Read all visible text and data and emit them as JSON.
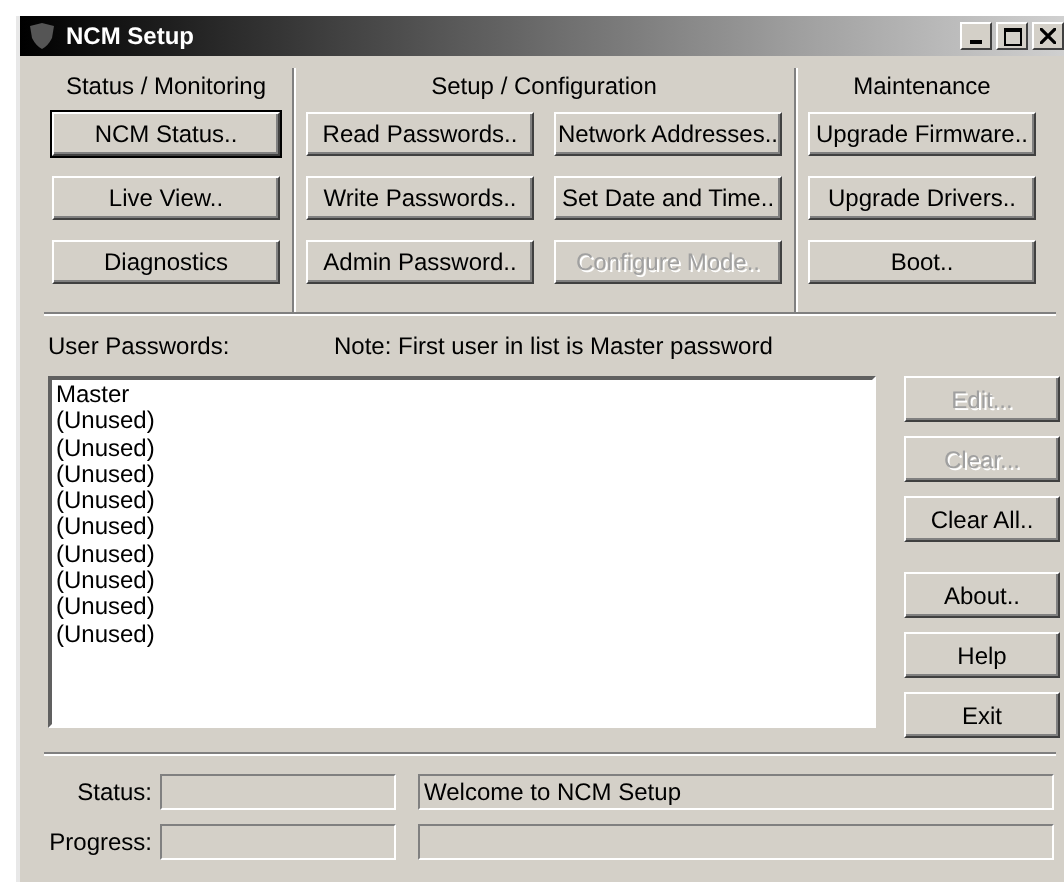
{
  "window": {
    "title": "NCM Setup"
  },
  "groups": [
    {
      "label": "Status / Monitoring",
      "buttons": [
        {
          "label": "NCM Status..",
          "disabled": false,
          "default": true
        },
        {
          "label": "Live View..",
          "disabled": false,
          "default": false
        },
        {
          "label": "Diagnostics",
          "disabled": false,
          "default": false
        }
      ]
    },
    {
      "label": "Setup / Configuration",
      "buttons": [
        {
          "label": "Read Passwords..",
          "disabled": false,
          "default": false
        },
        {
          "label": "Network Addresses..",
          "disabled": false,
          "default": false
        },
        {
          "label": "Write Passwords..",
          "disabled": false,
          "default": false
        },
        {
          "label": "Set Date and Time..",
          "disabled": false,
          "default": false
        },
        {
          "label": "Admin Password..",
          "disabled": false,
          "default": false
        },
        {
          "label": "Configure Mode..",
          "disabled": true,
          "default": false
        }
      ]
    },
    {
      "label": "Maintenance",
      "buttons": [
        {
          "label": "Upgrade Firmware..",
          "disabled": false,
          "default": false
        },
        {
          "label": "Upgrade Drivers..",
          "disabled": false,
          "default": false
        },
        {
          "label": "Boot..",
          "disabled": false,
          "default": false
        }
      ]
    }
  ],
  "passwords": {
    "label": "User Passwords:",
    "note": "Note: First user in list is Master password",
    "items": [
      "Master",
      "(Unused)",
      "(Unused)",
      "(Unused)",
      "(Unused)",
      "(Unused)",
      "(Unused)",
      "(Unused)",
      "(Unused)",
      "(Unused)"
    ]
  },
  "side_buttons": [
    {
      "label": "Edit...",
      "disabled": true
    },
    {
      "label": "Clear...",
      "disabled": true
    },
    {
      "label": "Clear All..",
      "disabled": false
    },
    {
      "label": "About..",
      "disabled": false
    },
    {
      "label": "Help",
      "disabled": false
    },
    {
      "label": "Exit",
      "disabled": false
    }
  ],
  "status_bar": {
    "status_label": "Status:",
    "status_message": "Welcome to NCM Setup",
    "progress_label": "Progress:"
  }
}
